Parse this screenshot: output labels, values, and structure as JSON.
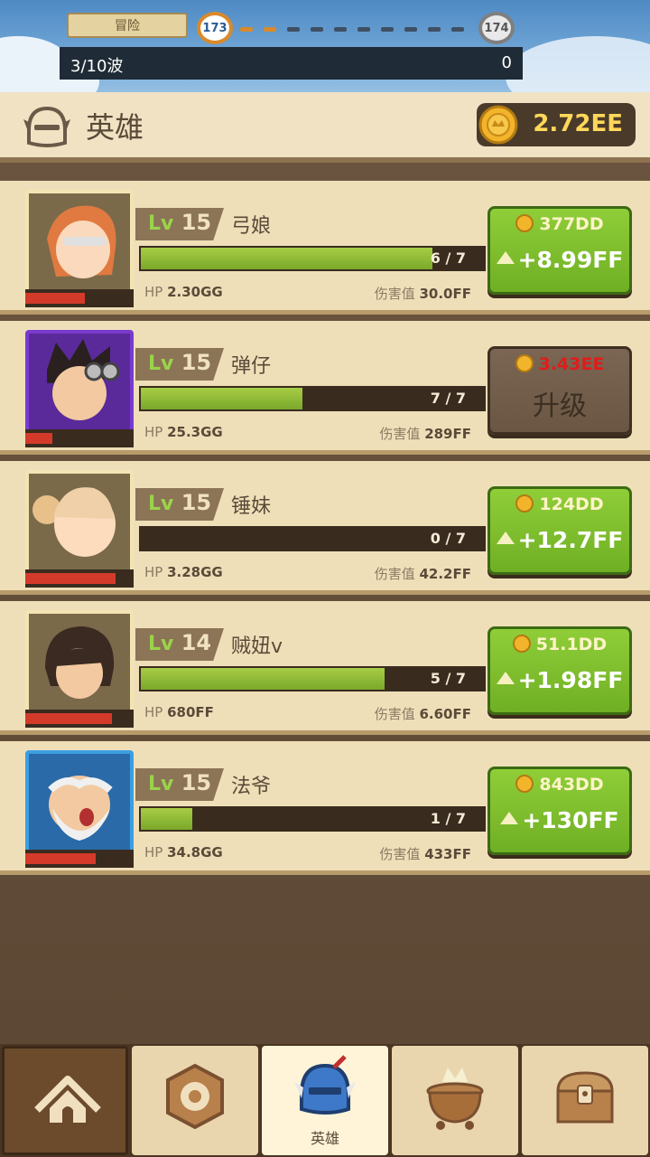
{
  "top": {
    "banner_label": "冒险",
    "current_stage": "173",
    "next_stage": "174",
    "wave_text": "3/10波",
    "wave_count": "0"
  },
  "header": {
    "title": "英雄",
    "gold": "2.72EE"
  },
  "heroes": [
    {
      "lv_prefix": "Lv",
      "level": "15",
      "name": "弓娘",
      "xp": "6 / 7",
      "xp_fraction": 0.85,
      "hp_label": "HP",
      "hp": "2.30GG",
      "dmg_label": "伤害值",
      "dmg": "30.0FF",
      "hp_fraction": 0.55,
      "cost": "377DD",
      "gain": "+8.99FF",
      "enabled": true
    },
    {
      "lv_prefix": "Lv",
      "level": "15",
      "name": "弹仔",
      "xp": "7 / 7",
      "xp_fraction": 0.47,
      "hp_label": "HP",
      "hp": "25.3GG",
      "dmg_label": "伤害值",
      "dmg": "289FF",
      "hp_fraction": 0.25,
      "cost": "3.43EE",
      "upgrade_text": "升级",
      "enabled": false
    },
    {
      "lv_prefix": "Lv",
      "level": "15",
      "name": "锤妹",
      "xp": "0 / 7",
      "xp_fraction": 0.0,
      "hp_label": "HP",
      "hp": "3.28GG",
      "dmg_label": "伤害值",
      "dmg": "42.2FF",
      "hp_fraction": 0.83,
      "cost": "124DD",
      "gain": "+12.7FF",
      "enabled": true
    },
    {
      "lv_prefix": "Lv",
      "level": "14",
      "name": "贼妞v",
      "xp": "5 / 7",
      "xp_fraction": 0.71,
      "hp_label": "HP",
      "hp": "680FF",
      "dmg_label": "伤害值",
      "dmg": "6.60FF",
      "hp_fraction": 0.8,
      "cost": "51.1DD",
      "gain": "+1.98FF",
      "enabled": true
    },
    {
      "lv_prefix": "Lv",
      "level": "15",
      "name": "法爷",
      "xp": "1 / 7",
      "xp_fraction": 0.15,
      "hp_label": "HP",
      "hp": "34.8GG",
      "dmg_label": "伤害值",
      "dmg": "433FF",
      "hp_fraction": 0.65,
      "cost": "843DD",
      "gain": "+130FF",
      "enabled": true
    }
  ],
  "nav": {
    "tabs": [
      {
        "icon": "camp-tent-icon"
      },
      {
        "icon": "hex-gear-icon"
      },
      {
        "icon": "knight-helmet-icon",
        "label": "英雄"
      },
      {
        "icon": "cauldron-icon"
      },
      {
        "icon": "treasure-chest-icon"
      }
    ]
  },
  "colors": {
    "accent_green": "#7fbf2e",
    "gold_text": "#ffd85a",
    "hp_red": "#d43a2a",
    "disabled_cost_red": "#e01c1c"
  }
}
